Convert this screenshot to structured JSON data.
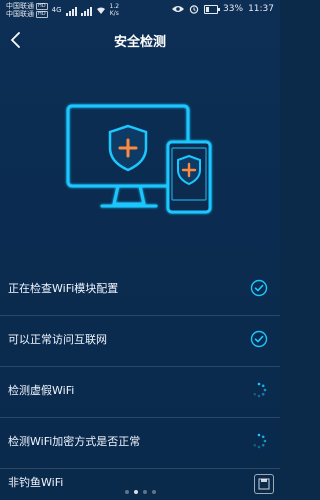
{
  "status_bar": {
    "carrier1": "中国联通",
    "carrier1_tag": "HD",
    "carrier2": "中国联通",
    "carrier2_tag": "HD",
    "network": "4G",
    "speed_value": "1.2",
    "speed_unit": "K/s",
    "battery": "33%",
    "battery_level": 0.33,
    "time": "11:37",
    "icons": [
      "eye-icon",
      "alarm-icon",
      "battery-icon"
    ]
  },
  "header": {
    "title": "安全检测",
    "back_icon": "chevron-left-icon"
  },
  "illustration": {
    "name": "monitor-and-phone-shield",
    "colors": {
      "stroke": "#1cc7ff",
      "shield": "#0e3b66",
      "plus": "#ff8a3d"
    }
  },
  "checks": [
    {
      "label": "正在检查WiFi模块配置",
      "status": "done",
      "icon": "check-circle-icon"
    },
    {
      "label": "可以正常访问互联网",
      "status": "done",
      "icon": "check-circle-icon"
    },
    {
      "label": "检测虚假WiFi",
      "status": "loading",
      "icon": "spinner-icon"
    },
    {
      "label": "检测WiFi加密方式是否正常",
      "status": "loading",
      "icon": "spinner-icon"
    },
    {
      "label": "非钓鱼WiFi",
      "status": "partial"
    }
  ],
  "pager": {
    "count": 4,
    "active_index": 1
  },
  "accent": "#1cc7ff"
}
